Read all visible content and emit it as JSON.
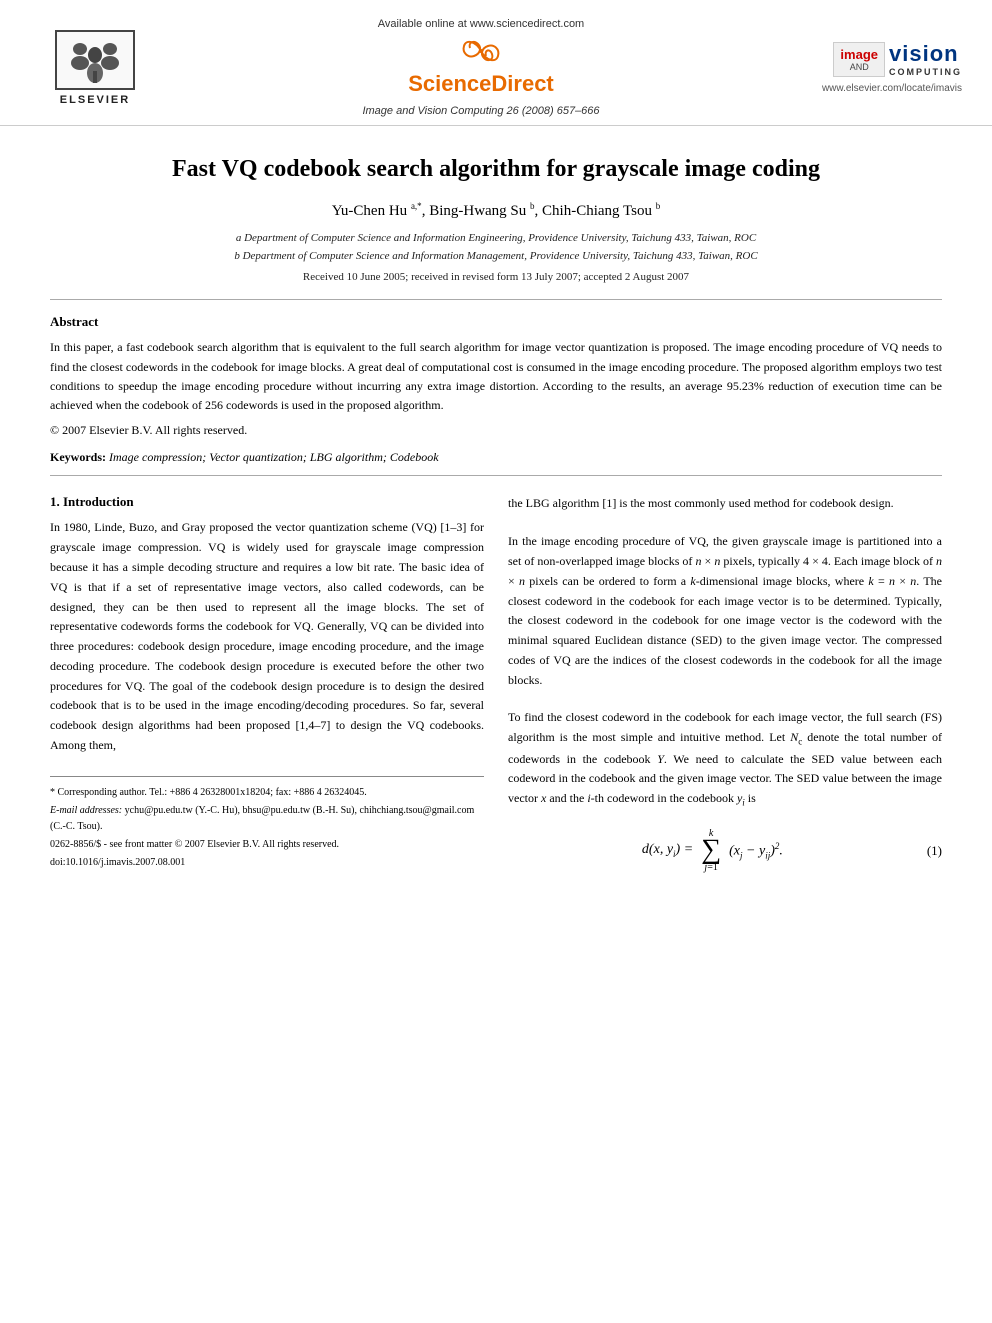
{
  "header": {
    "available_online": "Available online at www.sciencedirect.com",
    "sciencedirect_label": "ScienceDirect",
    "journal_name": "Image and Vision Computing 26 (2008) 657–666",
    "elsevier_label": "ELSEVIER",
    "website": "www.elsevier.com/locate/imavis",
    "ivc_image": "image",
    "ivc_and": "AND",
    "ivc_vision": "vision",
    "ivc_computing": "COMPUTING"
  },
  "paper": {
    "title": "Fast VQ codebook search algorithm for grayscale image coding",
    "authors": "Yu-Chen Hu a,*, Bing-Hwang Su b, Chih-Chiang Tsou b",
    "affiliation_a": "a Department of Computer Science and Information Engineering, Providence University, Taichung 433, Taiwan, ROC",
    "affiliation_b": "b Department of Computer Science and Information Management, Providence University, Taichung 433, Taiwan, ROC",
    "received": "Received 10 June 2005; received in revised form 13 July 2007; accepted 2 August 2007"
  },
  "abstract": {
    "title": "Abstract",
    "text": "In this paper, a fast codebook search algorithm that is equivalent to the full search algorithm for image vector quantization is proposed. The image encoding procedure of VQ needs to find the closest codewords in the codebook for image blocks. A great deal of computational cost is consumed in the image encoding procedure. The proposed algorithm employs two test conditions to speedup the image encoding procedure without incurring any extra image distortion. According to the results, an average 95.23% reduction of execution time can be achieved when the codebook of 256 codewords is used in the proposed algorithm.",
    "copyright": "© 2007 Elsevier B.V. All rights reserved.",
    "keywords_label": "Keywords:",
    "keywords": "Image compression; Vector quantization; LBG algorithm; Codebook"
  },
  "section1": {
    "title": "1. Introduction",
    "col_left": "In 1980, Linde, Buzo, and Gray proposed the vector quantization scheme (VQ) [1–3] for grayscale image compression. VQ is widely used for grayscale image compression because it has a simple decoding structure and requires a low bit rate. The basic idea of VQ is that if a set of representative image vectors, also called codewords, can be designed, they can be then used to represent all the image blocks. The set of representative codewords forms the codebook for VQ. Generally, VQ can be divided into three procedures: codebook design procedure, image encoding procedure, and the image decoding procedure. The codebook design procedure is executed before the other two procedures for VQ. The goal of the codebook design procedure is to design the desired codebook that is to be used in the image encoding/decoding procedures. So far, several codebook design algorithms had been proposed [1,4–7] to design the VQ codebooks. Among them,",
    "col_right": "the LBG algorithm [1] is the most commonly used method for codebook design.\n\nIn the image encoding procedure of VQ, the given grayscale image is partitioned into a set of non-overlapped image blocks of n × n pixels, typically 4 × 4. Each image block of n × n pixels can be ordered to form a k-dimensional image blocks, where k = n × n. The closest codeword in the codebook for each image vector is to be determined. Typically, the closest codeword in the codebook for one image vector is the codeword with the minimal squared Euclidean distance (SED) to the given image vector. The compressed codes of VQ are the indices of the closest codewords in the codebook for all the image blocks.\n\nTo find the closest codeword in the codebook for each image vector, the full search (FS) algorithm is the most simple and intuitive method. Let Nc denote the total number of codewords in the codebook Y. We need to calculate the SED value between each codeword in the codebook and the given image vector. The SED value between the image vector x and the i-th codeword in the codebook yi is"
  },
  "formula": {
    "label": "d(x, y_i) =",
    "summation": "∑",
    "sum_from": "j=1",
    "sum_to": "k",
    "expression": "(x_j − y_ij)²",
    "number": "(1)"
  },
  "footnotes": {
    "corresponding": "* Corresponding author. Tel.: +886 4 26328001x18204; fax: +886 4 26324045.",
    "email": "E-mail addresses: ychu@pu.edu.tw (Y.-C. Hu), bhsu@pu.edu.tw (B.-H. Su), chihchiang.tsou@gmail.com (C.-C. Tsou).",
    "issn": "0262-8856/$ - see front matter © 2007 Elsevier B.V. All rights reserved.",
    "doi": "doi:10.1016/j.imavis.2007.08.001"
  }
}
